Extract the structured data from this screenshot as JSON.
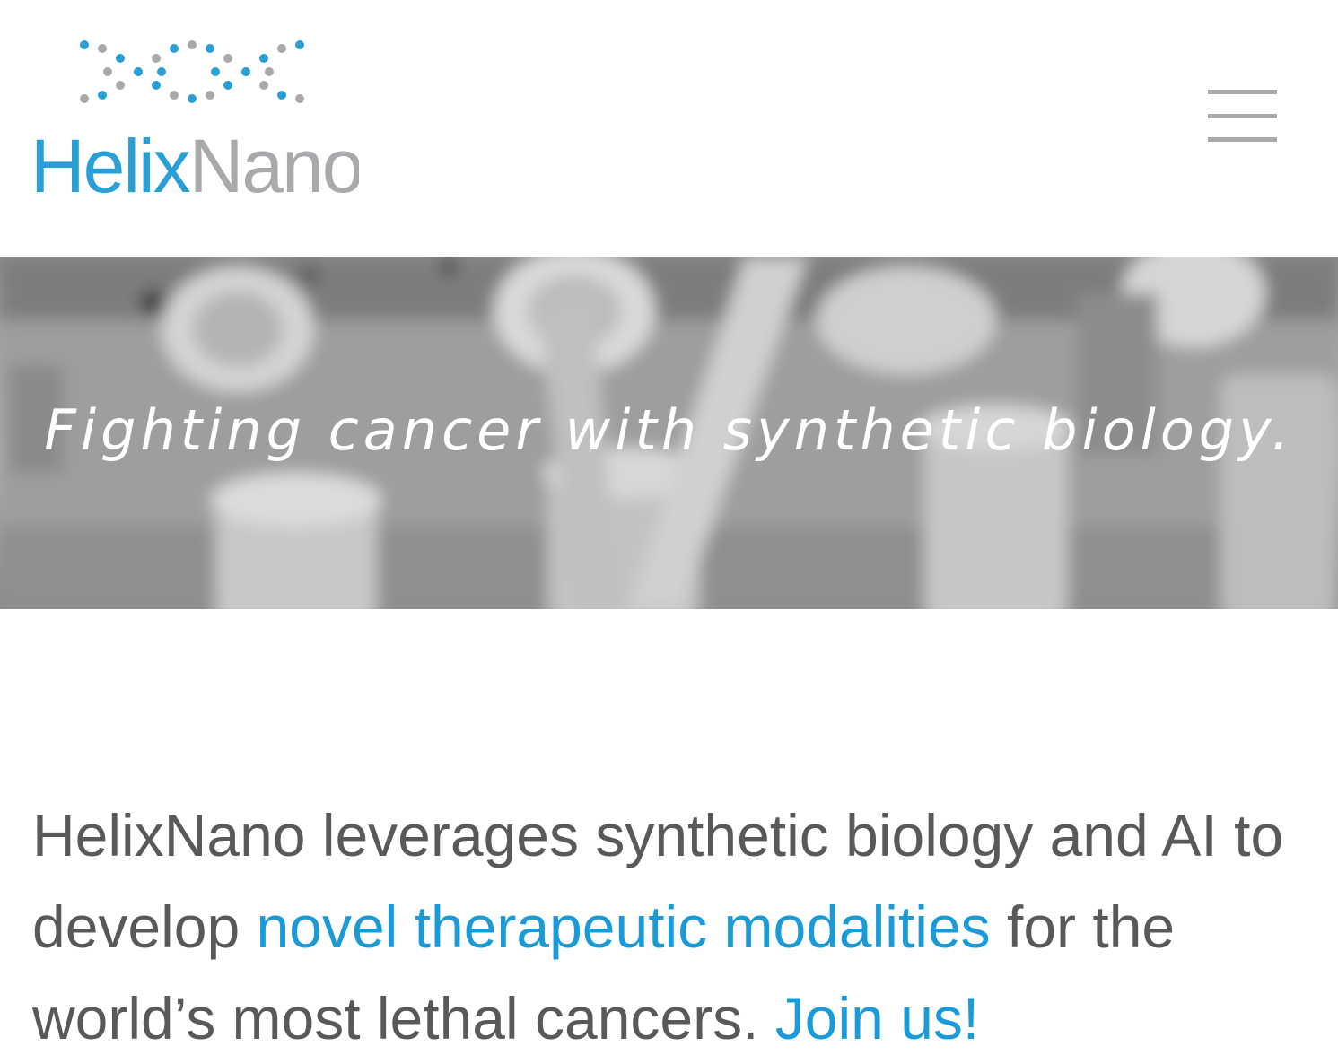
{
  "brand": {
    "name_part1": "Helix",
    "name_part2": "Nano",
    "colors": {
      "blue": "#2a9fd6",
      "gray": "#a7a9ac"
    }
  },
  "menu": {
    "icon": "hamburger-menu-icon"
  },
  "hero": {
    "tagline": "Fighting cancer with synthetic biology."
  },
  "intro": {
    "text_before": "HelixNano leverages synthetic biology and AI to develop ",
    "link1": "novel therapeutic modalities",
    "text_middle": " for the world’s most lethal cancers. ",
    "link2": "Join us!"
  },
  "colors": {
    "body_text": "#58595b",
    "link": "#1a9bd7"
  }
}
